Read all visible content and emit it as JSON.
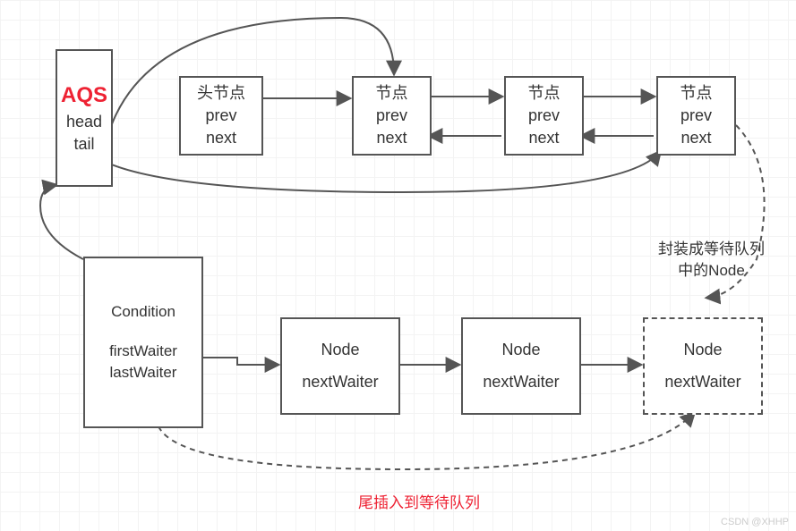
{
  "aqs": {
    "title": "AQS",
    "f1": "head",
    "f2": "tail"
  },
  "head_node": {
    "title": "头节点",
    "f1": "prev",
    "f2": "next"
  },
  "node": {
    "title": "节点",
    "f1": "prev",
    "f2": "next"
  },
  "cond": {
    "title": "Condition",
    "f1": "firstWaiter",
    "f2": "lastWaiter"
  },
  "wnode": {
    "title": "Node",
    "f1": "nextWaiter"
  },
  "anno1_l1": "封装成等待队列",
  "anno1_l2": "中的Node",
  "anno2": "尾插入到等待队列",
  "watermark": "CSDN @XHHP"
}
